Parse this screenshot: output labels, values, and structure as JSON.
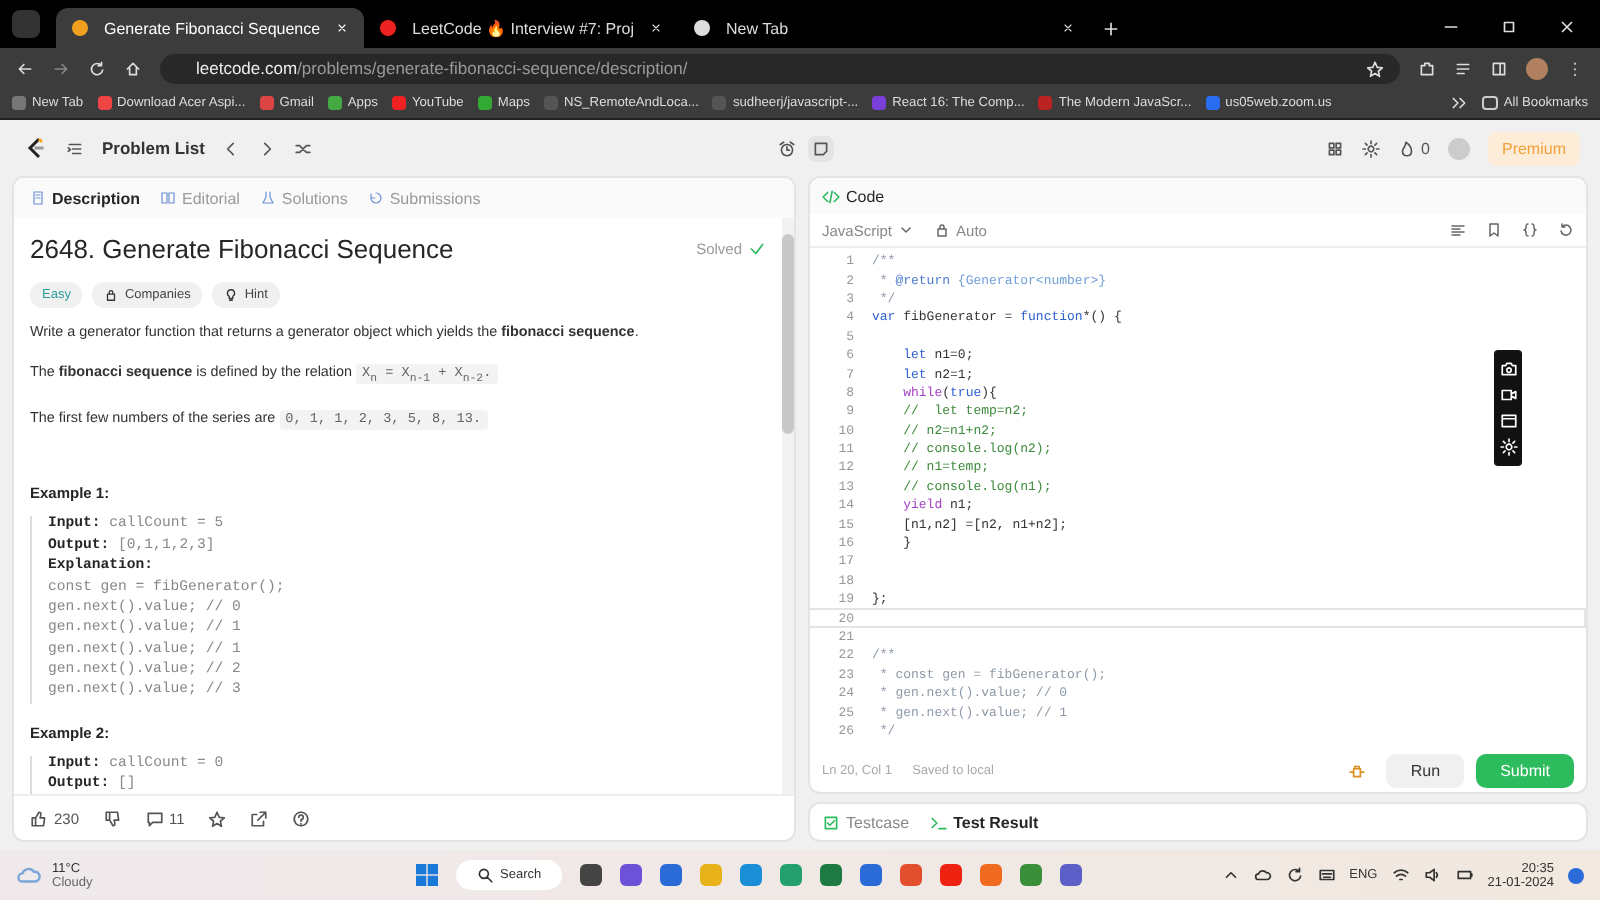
{
  "browser": {
    "tabs": [
      {
        "title": "Generate Fibonacci Sequence",
        "selected": true
      },
      {
        "title": "LeetCode 🔥 Interview #7: Proj",
        "selected": false
      },
      {
        "title": "New Tab",
        "selected": false
      }
    ],
    "url": {
      "host": "leetcode.com",
      "path": "/problems/generate-fibonacci-sequence/description/"
    },
    "bookmarks": [
      "New Tab",
      "Download Acer Aspi...",
      "Gmail",
      "Apps",
      "YouTube",
      "Maps",
      "NS_RemoteAndLoca...",
      "sudheerj/javascript-...",
      "React 16: The Comp...",
      "The Modern JavaScr...",
      "us05web.zoom.us"
    ],
    "all_bookmarks": "All Bookmarks"
  },
  "nav": {
    "problem_list": "Problem List",
    "streak": "0",
    "premium": "Premium"
  },
  "description": {
    "tabs": [
      {
        "label": "Description",
        "selected": true
      },
      {
        "label": "Editorial",
        "selected": false
      },
      {
        "label": "Solutions",
        "selected": false
      },
      {
        "label": "Submissions",
        "selected": false
      }
    ],
    "title": "2648. Generate Fibonacci Sequence",
    "status": "Solved",
    "difficulty": "Easy",
    "tags": [
      "Companies",
      "Hint"
    ],
    "paragraphs": [
      {
        "text": "Write a generator function that returns a generator object which yields the **fibonacci sequence**."
      },
      {
        "text": "The **fibonacci sequence** is defined by the relation",
        "code": "X$_{n}$ = X$_{n-1}$ + X$_{n-2}$."
      },
      {
        "text": "The first few numbers of the series are",
        "code": "0, 1, 1, 2, 3, 5, 8, 13."
      }
    ],
    "examples": [
      {
        "title": "Example 1:",
        "lines": [
          {
            "kind": "field",
            "label": "Input:",
            "value": "callCount = 5"
          },
          {
            "kind": "field",
            "label": "Output:",
            "value": "[0,1,1,2,3]"
          },
          {
            "kind": "label",
            "label": "Explanation:"
          },
          {
            "kind": "code",
            "value": "const gen = fibGenerator();"
          },
          {
            "kind": "code",
            "value": "gen.next().value; // 0"
          },
          {
            "kind": "code",
            "value": "gen.next().value; // 1"
          },
          {
            "kind": "code",
            "value": "gen.next().value; // 1"
          },
          {
            "kind": "code",
            "value": "gen.next().value; // 2"
          },
          {
            "kind": "code",
            "value": "gen.next().value; // 3"
          }
        ]
      },
      {
        "title": "Example 2:",
        "lines": [
          {
            "kind": "field",
            "label": "Input:",
            "value": "callCount = 0"
          },
          {
            "kind": "field",
            "label": "Output:",
            "value": "[]"
          }
        ]
      }
    ],
    "likes": "230",
    "comments": "11"
  },
  "code": {
    "title": "Code",
    "language": "JavaScript",
    "mode": "Auto",
    "lines": [
      {
        "no": "1",
        "selected": false,
        "parts": [
          {
            "kind": "comment",
            "text": "/**"
          }
        ]
      },
      {
        "no": "2",
        "selected": false,
        "parts": [
          {
            "kind": "comment",
            "text": " * "
          },
          {
            "kind": "tag",
            "text": "@return"
          },
          {
            "kind": "type",
            "text": " {Generator<number>}"
          }
        ]
      },
      {
        "no": "3",
        "selected": false,
        "parts": [
          {
            "kind": "comment",
            "text": " */"
          }
        ]
      },
      {
        "no": "4",
        "selected": false,
        "parts": [
          {
            "kind": "keyword",
            "text": "var"
          },
          {
            "kind": "plain",
            "text": " fibGenerator = "
          },
          {
            "kind": "keyword",
            "text": "function"
          },
          {
            "kind": "plain",
            "text": "*() {"
          }
        ]
      },
      {
        "no": "5",
        "selected": false
      },
      {
        "no": "6",
        "selected": false,
        "parts": [
          {
            "kind": "keyword",
            "text": "    let"
          },
          {
            "kind": "plain",
            "text": " n1=0;"
          }
        ]
      },
      {
        "no": "7",
        "selected": false,
        "parts": [
          {
            "kind": "keyword",
            "text": "    let"
          },
          {
            "kind": "plain",
            "text": " n2=1;"
          }
        ]
      },
      {
        "no": "8",
        "selected": false,
        "parts": [
          {
            "kind": "control",
            "text": "    while"
          },
          {
            "kind": "plain",
            "text": "("
          },
          {
            "kind": "keyword",
            "text": "true"
          },
          {
            "kind": "plain",
            "text": "){"
          }
        ]
      },
      {
        "no": "9",
        "selected": false,
        "parts": [
          {
            "kind": "linecomment",
            "text": "    //  let temp=n2;"
          }
        ]
      },
      {
        "no": "10",
        "selected": false,
        "parts": [
          {
            "kind": "linecomment",
            "text": "    // n2=n1+n2;"
          }
        ]
      },
      {
        "no": "11",
        "selected": false,
        "parts": [
          {
            "kind": "linecomment",
            "text": "    // console.log(n2);"
          }
        ]
      },
      {
        "no": "12",
        "selected": false,
        "parts": [
          {
            "kind": "linecomment",
            "text": "    // n1=temp;"
          }
        ]
      },
      {
        "no": "13",
        "selected": false,
        "parts": [
          {
            "kind": "linecomment",
            "text": "    // console.log(n1);"
          }
        ]
      },
      {
        "no": "14",
        "selected": false,
        "parts": [
          {
            "kind": "control",
            "text": "    yield"
          },
          {
            "kind": "plain",
            "text": " n1;"
          }
        ]
      },
      {
        "no": "15",
        "selected": false,
        "parts": [
          {
            "kind": "plain",
            "text": "    [n1,n2] =[n2, n1+n2];"
          }
        ]
      },
      {
        "no": "16",
        "selected": false,
        "parts": [
          {
            "kind": "plain",
            "text": "    }"
          }
        ]
      },
      {
        "no": "17",
        "selected": false
      },
      {
        "no": "18",
        "selected": false
      },
      {
        "no": "19",
        "selected": false,
        "parts": [
          {
            "kind": "plain",
            "text": "};"
          }
        ]
      },
      {
        "no": "20",
        "selected": true
      },
      {
        "no": "21",
        "selected": false
      },
      {
        "no": "22",
        "selected": false,
        "parts": [
          {
            "kind": "comment",
            "text": "/**"
          }
        ]
      },
      {
        "no": "23",
        "selected": false,
        "parts": [
          {
            "kind": "comment",
            "text": " * const gen = fibGenerator();"
          }
        ]
      },
      {
        "no": "24",
        "selected": false,
        "parts": [
          {
            "kind": "comment",
            "text": " * gen.next().value; // 0"
          }
        ]
      },
      {
        "no": "25",
        "selected": false,
        "parts": [
          {
            "kind": "comment",
            "text": " * gen.next().value; // 1"
          }
        ]
      },
      {
        "no": "26",
        "selected": false,
        "parts": [
          {
            "kind": "comment",
            "text": " */"
          }
        ]
      }
    ],
    "cursor": "Ln 20, Col 1",
    "saved": "Saved to local",
    "run": "Run",
    "submit": "Submit"
  },
  "console": {
    "tabs": [
      {
        "label": "Testcase",
        "selected": false
      },
      {
        "label": "Test Result",
        "selected": true
      }
    ]
  },
  "taskbar": {
    "temperature": "11°C",
    "weather": "Cloudy",
    "search": "Search",
    "language": "ENG",
    "time": "20:35",
    "date": "21-01-2024"
  }
}
